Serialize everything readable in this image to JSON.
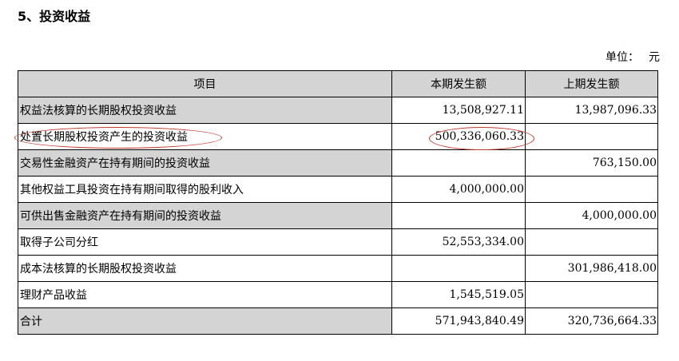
{
  "heading": "5、投资收益",
  "unit": {
    "label": "单位：",
    "value": "元"
  },
  "columns": [
    "项目",
    "本期发生额",
    "上期发生额"
  ],
  "rows": [
    {
      "item": "权益法核算的长期股权投资收益",
      "current": "13,508,927.11",
      "previous": "13,987,096.33"
    },
    {
      "item": "处置长期股权投资产生的投资收益",
      "current": "500,336,060.33",
      "previous": ""
    },
    {
      "item": "交易性金融资产在持有期间的投资收益",
      "current": "",
      "previous": "763,150.00"
    },
    {
      "item": "其他权益工具投资在持有期间取得的股利收入",
      "current": "4,000,000.00",
      "previous": ""
    },
    {
      "item": "可供出售金融资产在持有期间的投资收益",
      "current": "",
      "previous": "4,000,000.00"
    },
    {
      "item": "取得子公司分红",
      "current": "52,553,334.00",
      "previous": ""
    },
    {
      "item": "成本法核算的长期股权投资收益",
      "current": "",
      "previous": "301,986,418.00"
    },
    {
      "item": "理财产品收益",
      "current": "1,545,519.05",
      "previous": ""
    },
    {
      "item": "合计",
      "current": "571,943,840.49",
      "previous": "320,736,664.33"
    }
  ],
  "colors": {
    "header_fill": "#d4d4d4",
    "annotation": "#c0392b"
  }
}
